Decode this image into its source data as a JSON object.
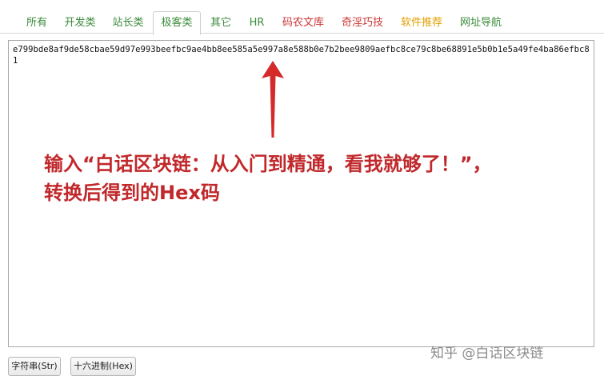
{
  "tabs": [
    {
      "label": "所有",
      "color": "#3a8a3a"
    },
    {
      "label": "开发类",
      "color": "#3a8a3a"
    },
    {
      "label": "站长类",
      "color": "#3a8a3a"
    },
    {
      "label": "极客类",
      "color": "#3a8a3a",
      "active": true
    },
    {
      "label": "其它",
      "color": "#3a8a3a"
    },
    {
      "label": "HR",
      "color": "#3a8a3a"
    },
    {
      "label": "码农文库",
      "color": "#cc3333"
    },
    {
      "label": "奇淫巧技",
      "color": "#cc3333"
    },
    {
      "label": "软件推荐",
      "color": "#e0a000"
    },
    {
      "label": "网址导航",
      "color": "#3a8a3a"
    }
  ],
  "textarea": {
    "value": "e799bde8af9de58cbae59d97e993beefbc9ae4bb8ee585a5e997a8e588b0e7b2bee9809aefbc8ce79c8be68891e5b0b1e5a49fe4ba86efbc81"
  },
  "annotation": {
    "line1": "输入“白话区块链：从入门到精通，看我就够了！”，",
    "line2": "转换后得到的Hex码",
    "color": "#c0282b"
  },
  "buttons": {
    "to_string": "字符串(Str)",
    "to_hex": "十六进制(Hex)"
  },
  "watermark": "知乎 @白话区块链"
}
